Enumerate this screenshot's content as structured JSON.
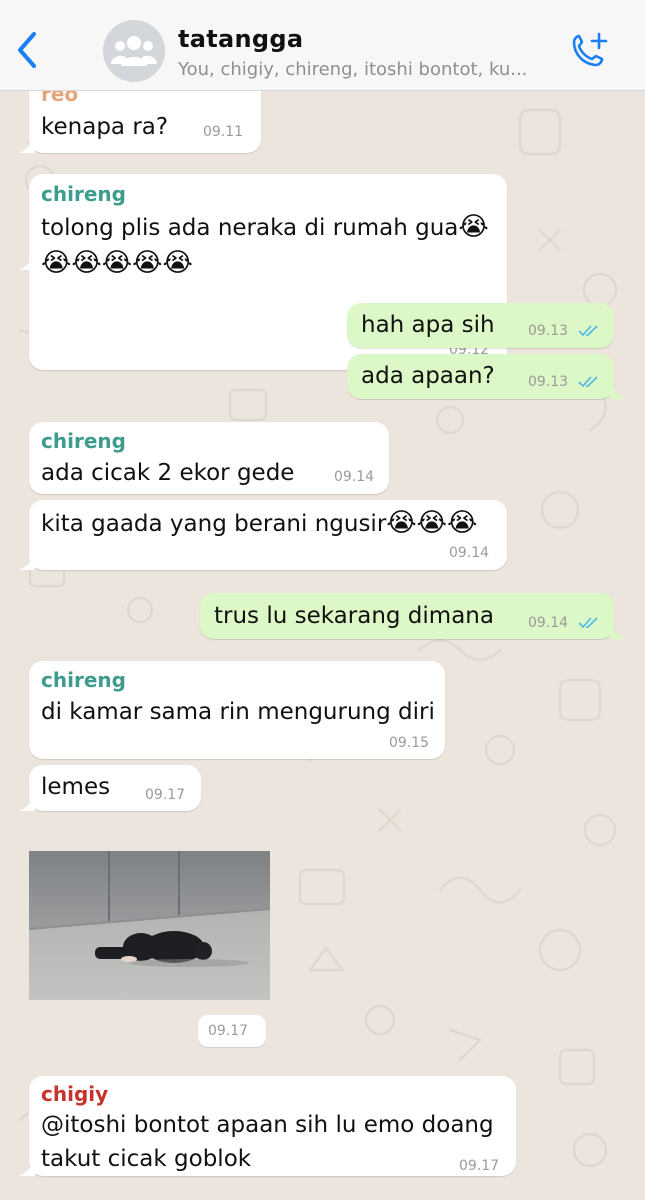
{
  "header": {
    "title": "tatangga",
    "subtitle": "You, chigiy, chireng, itoshi bontot, ku...",
    "back_icon": "chevron-left-icon",
    "call_icon": "phone-plus-icon",
    "accent": "#1a7ef5"
  },
  "colors": {
    "chireng": "#3d9c8e",
    "reo": "#e8a579",
    "chigiy": "#c8322d",
    "incoming_bubble": "#ffffff",
    "outgoing_bubble": "#dcf8c6",
    "read_ticks": "#4fb6ec"
  },
  "messages": [
    {
      "sender": "reo",
      "text": "kenapa ra?",
      "time": "09.11"
    },
    {
      "sender": "chireng",
      "text": "tolong plis ada neraka di rumah gua",
      "text2": "",
      "emoji": "😭",
      "time": "09.12"
    },
    {
      "text": "hah apa sih",
      "time": "09.13"
    },
    {
      "text": "ada apaan?",
      "time": "09.13"
    },
    {
      "sender": "chireng",
      "text": "ada cicak 2 ekor gede",
      "time": "09.14"
    },
    {
      "text": "kita gaada yang berani ngusir",
      "time": "09.14"
    },
    {
      "text": "trus lu sekarang dimana",
      "time": "09.14"
    },
    {
      "sender": "chireng",
      "text": "di kamar sama rin mengurung diri",
      "time": "09.15"
    },
    {
      "text": "lemes",
      "time": "09.17"
    },
    {
      "image": "photo-person-bowing-on-floor",
      "time": "09.17"
    },
    {
      "sender": "chigiy",
      "text": "@itoshi bontot apaan sih lu emo doang",
      "text2": "takut cicak goblok",
      "time": "09.17"
    }
  ]
}
